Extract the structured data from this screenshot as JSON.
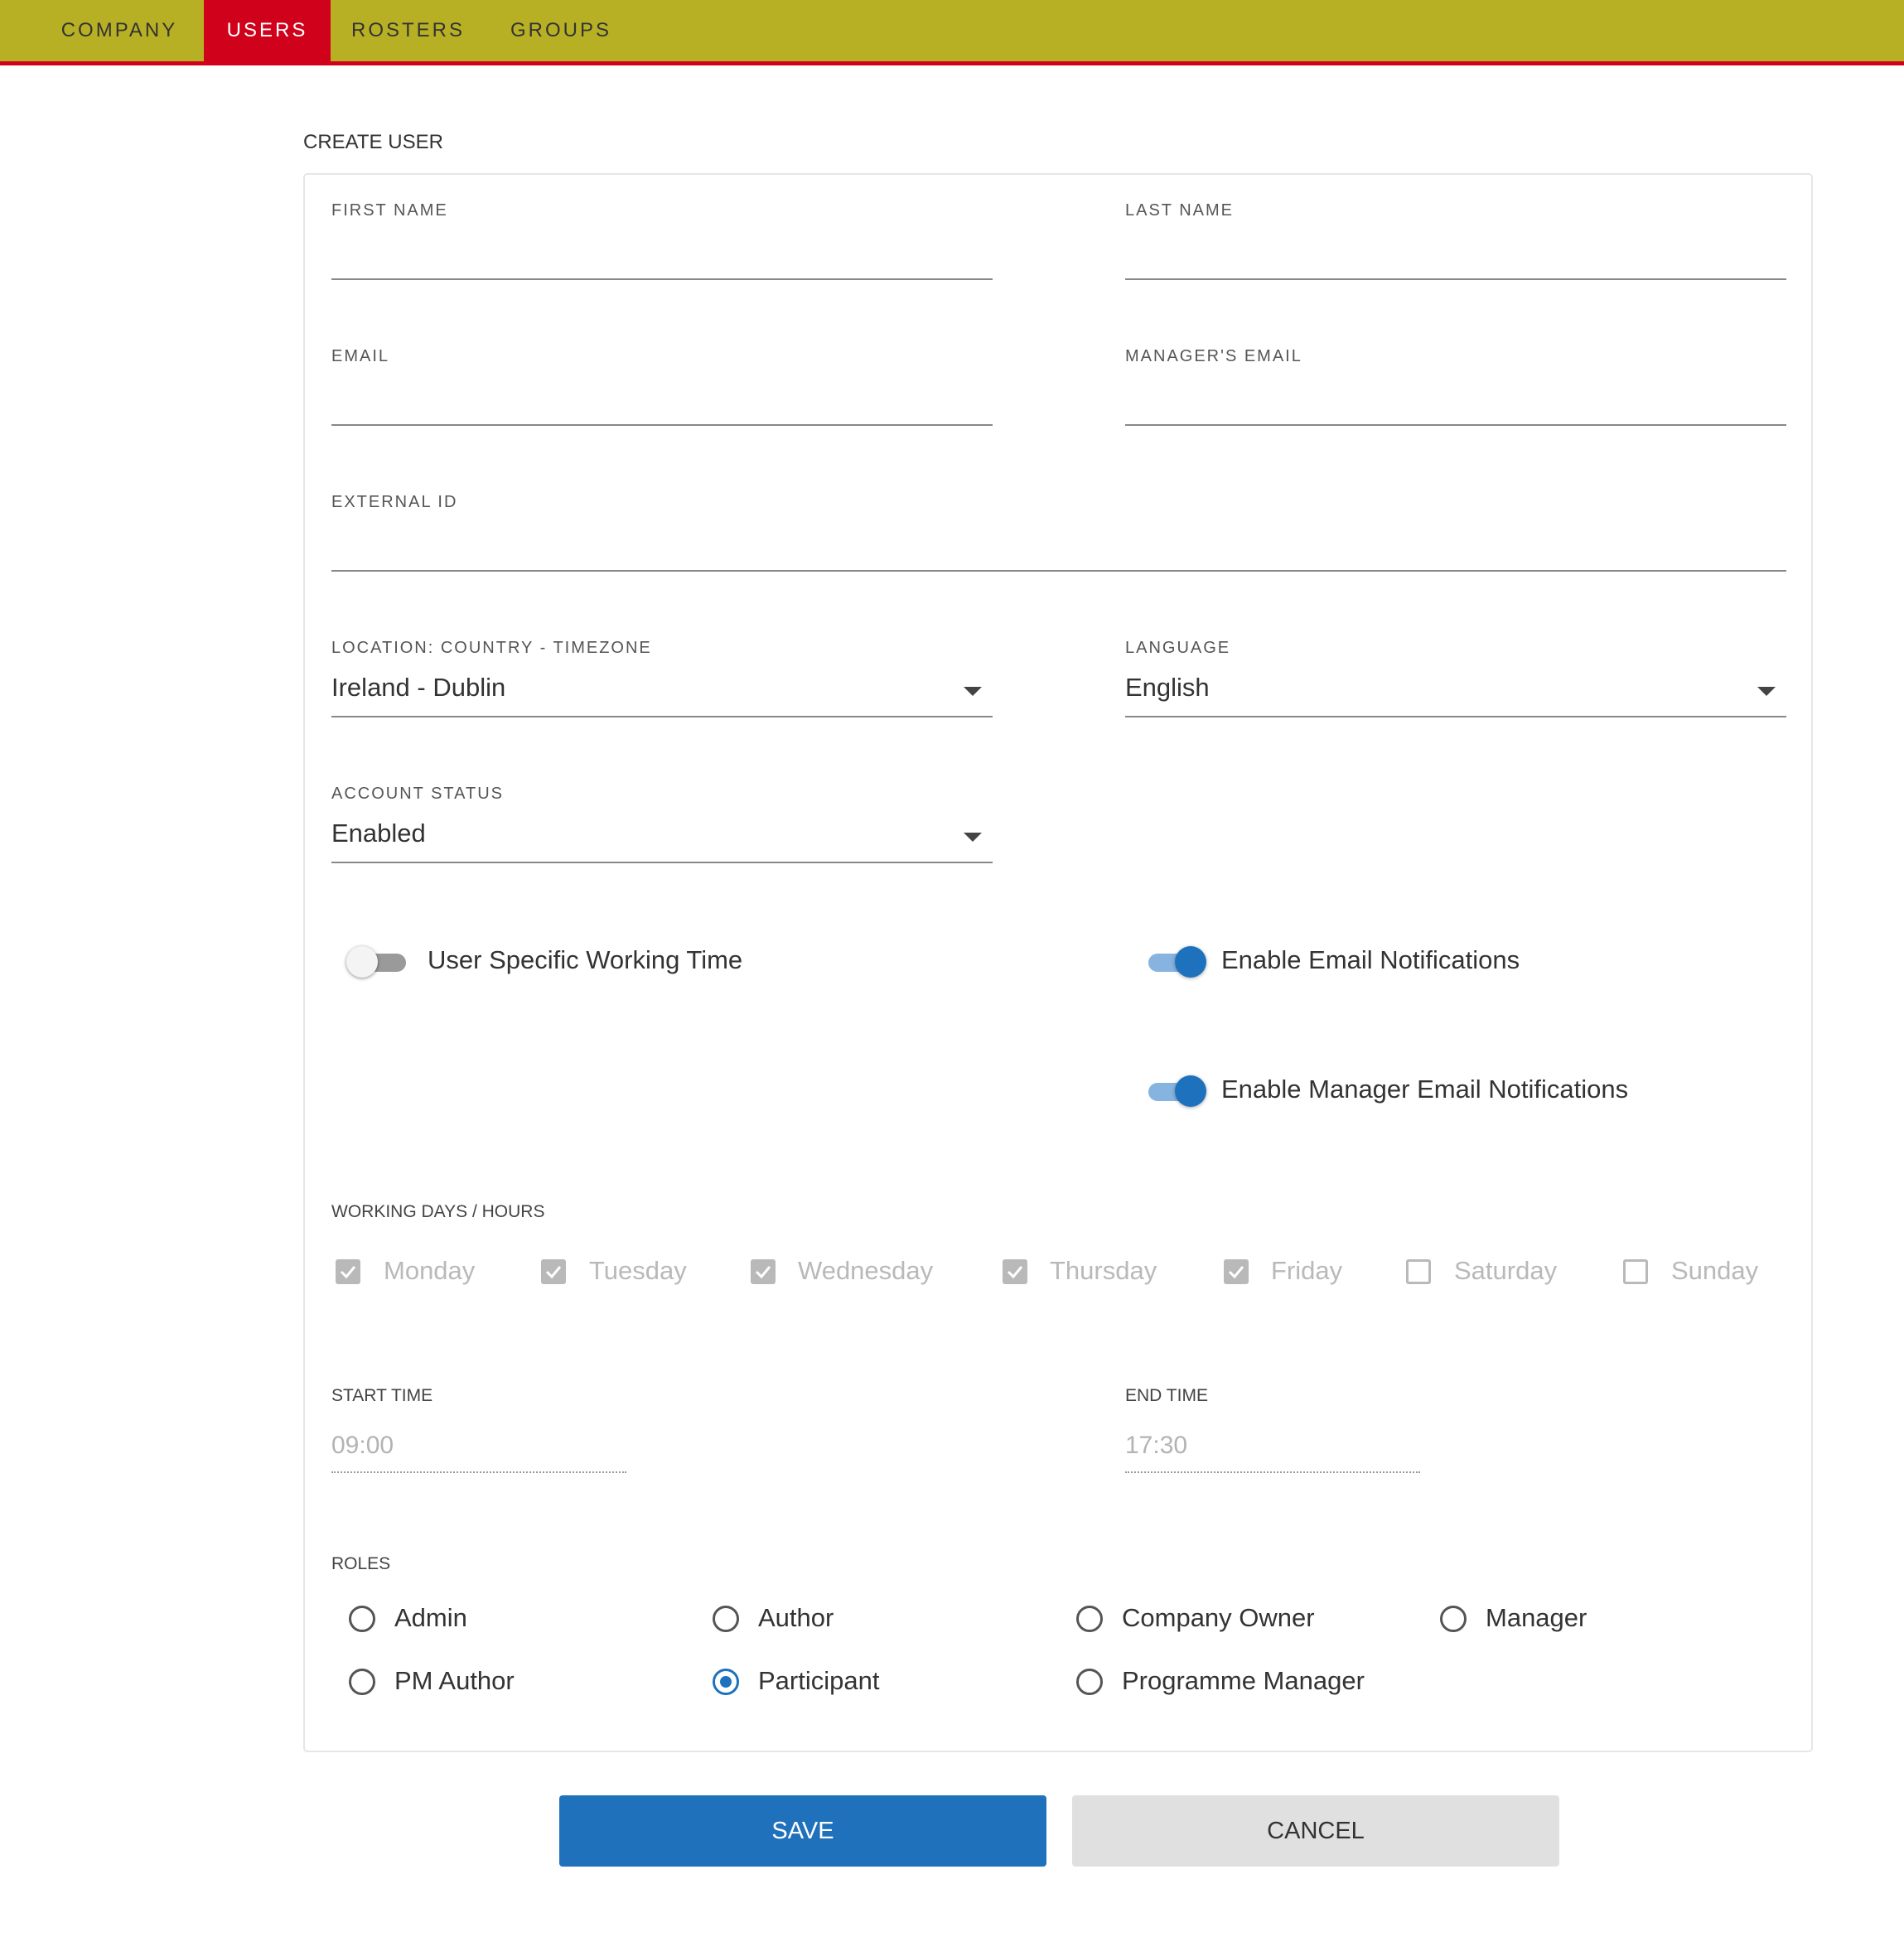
{
  "nav": {
    "tabs": [
      {
        "label": "COMPANY",
        "active": false
      },
      {
        "label": "USERS",
        "active": true
      },
      {
        "label": "ROSTERS",
        "active": false
      },
      {
        "label": "GROUPS",
        "active": false
      }
    ],
    "bar_color": "#b8b024",
    "active_color": "#d0021b"
  },
  "form": {
    "title": "CREATE USER",
    "fields": {
      "first_name": {
        "label": "FIRST NAME",
        "value": ""
      },
      "last_name": {
        "label": "LAST NAME",
        "value": ""
      },
      "email": {
        "label": "EMAIL",
        "value": ""
      },
      "managers_email": {
        "label": "MANAGER'S EMAIL",
        "value": ""
      },
      "external_id": {
        "label": "EXTERNAL ID",
        "value": ""
      },
      "location": {
        "label": "LOCATION: COUNTRY - TIMEZONE",
        "value": "Ireland - Dublin"
      },
      "language": {
        "label": "LANGUAGE",
        "value": "English"
      },
      "account_status": {
        "label": "ACCOUNT STATUS",
        "value": "Enabled"
      }
    },
    "toggles": {
      "user_specific_working_time": {
        "label": "User Specific Working Time",
        "on": false
      },
      "email_notifications": {
        "label": "Enable Email Notifications",
        "on": true
      },
      "manager_email_notifications": {
        "label": "Enable Manager Email Notifications",
        "on": true
      }
    },
    "working_days": {
      "label": "WORKING DAYS / HOURS",
      "days": [
        {
          "label": "Monday",
          "checked": true
        },
        {
          "label": "Tuesday",
          "checked": true
        },
        {
          "label": "Wednesday",
          "checked": true
        },
        {
          "label": "Thursday",
          "checked": true
        },
        {
          "label": "Friday",
          "checked": true
        },
        {
          "label": "Saturday",
          "checked": false
        },
        {
          "label": "Sunday",
          "checked": false
        }
      ]
    },
    "start_time": {
      "label": "START TIME",
      "value": "09:00"
    },
    "end_time": {
      "label": "END TIME",
      "value": "17:30"
    },
    "roles": {
      "label": "ROLES",
      "options": [
        {
          "label": "Admin",
          "selected": false
        },
        {
          "label": "Author",
          "selected": false
        },
        {
          "label": "Company Owner",
          "selected": false
        },
        {
          "label": "Manager",
          "selected": false
        },
        {
          "label": "PM Author",
          "selected": false
        },
        {
          "label": "Participant",
          "selected": true
        },
        {
          "label": "Programme Manager",
          "selected": false
        }
      ]
    },
    "accent_color": "#1e72bd"
  },
  "actions": {
    "save_label": "SAVE",
    "cancel_label": "CANCEL"
  }
}
